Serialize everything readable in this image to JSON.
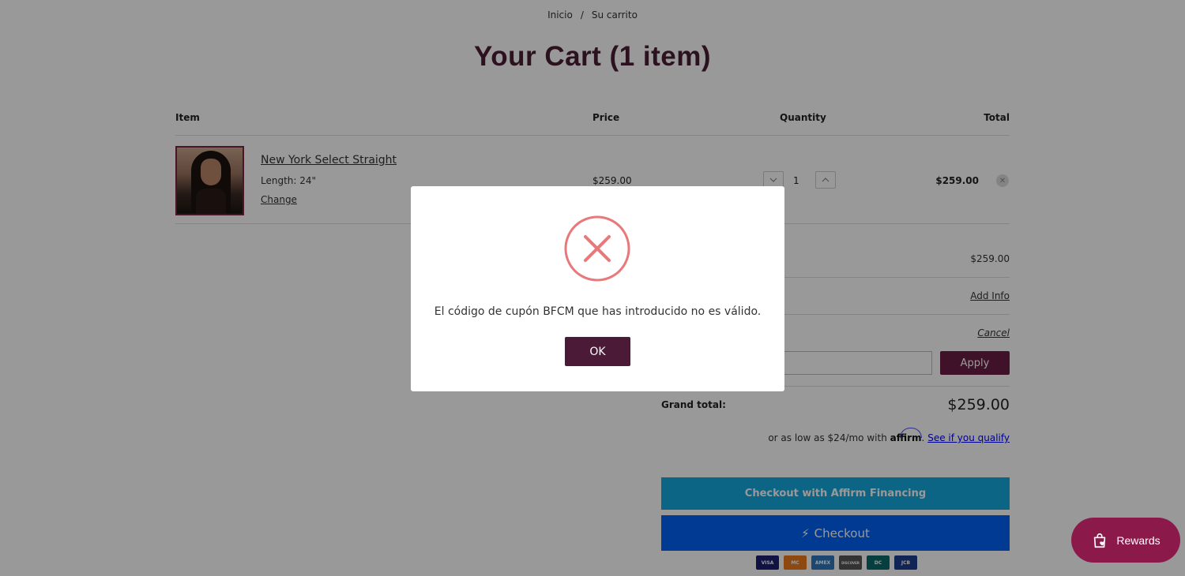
{
  "breadcrumb": {
    "home": "Inicio",
    "separator": "/",
    "current": "Su carrito"
  },
  "page_title": "Your Cart (1 item)",
  "table": {
    "headers": {
      "item": "Item",
      "price": "Price",
      "quantity": "Quantity",
      "total": "Total"
    }
  },
  "cart_item": {
    "name": "New York Select Straight",
    "length": "Length: 24\"",
    "change": "Change",
    "price": "$259.00",
    "quantity": "1",
    "total": "$259.00",
    "qty_down_icon": "chevron-down-icon",
    "qty_up_icon": "chevron-up-icon",
    "remove_icon": "close-icon"
  },
  "summary": {
    "subtotal": "$259.00",
    "add_info": "Add Info",
    "cancel": "Cancel",
    "coupon_value": "",
    "apply": "Apply",
    "grand_label": "Grand total:",
    "grand_value": "$259.00",
    "affirm_prefix": "or as low as $24/mo with",
    "affirm_brand": "affirm",
    "affirm_dot": ".",
    "affirm_qualify": "See if you qualify",
    "affirm_button": "Checkout with Affirm Financing",
    "checkout_button": "Checkout"
  },
  "cards": [
    {
      "name": "VISA",
      "color": "#1a1f71"
    },
    {
      "name": "MC",
      "color": "#eb7a1b"
    },
    {
      "name": "AMEX",
      "color": "#2e77bb"
    },
    {
      "name": "DISCOVER",
      "color": "#555555"
    },
    {
      "name": "DC",
      "color": "#0b6a6a"
    },
    {
      "name": "JCB",
      "color": "#1c3c8f"
    }
  ],
  "rewards": {
    "label": "Rewards"
  },
  "modal": {
    "message": "El código de cupón BFCM que has introducido no es válido.",
    "ok": "OK",
    "error_color": "#e8787a"
  },
  "colors": {
    "title": "#4a1d34",
    "apply": "#6b1e45",
    "affirm_btn": "#17a8e0",
    "checkout_btn": "#0062f5",
    "rewards": "#8b1a4a",
    "ok": "#4a1a36"
  }
}
